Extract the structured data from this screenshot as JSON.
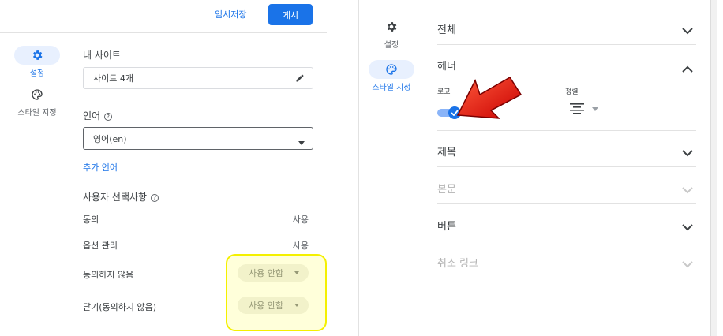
{
  "left_panel": {
    "topbar": {
      "draft_label": "임시저장",
      "publish_label": "게시"
    },
    "rail": [
      {
        "label": "설정",
        "icon": "gear-icon",
        "active": true
      },
      {
        "label": "스타일 지정",
        "icon": "palette-icon",
        "active": false
      }
    ],
    "my_site": {
      "title": "내 사이트",
      "value": "사이트 4개"
    },
    "language": {
      "title": "언어",
      "selected": "영어(en)",
      "add_label": "추가 언어"
    },
    "preferences": {
      "title": "사용자 선택사항",
      "rows": [
        {
          "label": "동의",
          "value": "사용"
        },
        {
          "label": "옵션 관리",
          "value": "사용"
        },
        {
          "label": "동의하지 않음",
          "value": "사용 안함"
        },
        {
          "label": "닫기(동의하지 않음)",
          "value": "사용 안함"
        }
      ]
    }
  },
  "right_panel": {
    "rail": [
      {
        "label": "설정",
        "icon": "gear-icon",
        "active": false
      },
      {
        "label": "스타일 지정",
        "icon": "palette-icon",
        "active": true
      }
    ],
    "sections": {
      "all": "전체",
      "header": "헤더",
      "title": "제목",
      "body": "본문",
      "button": "버튼",
      "cancel_link": "취소 링크"
    },
    "header_controls": {
      "logo_label": "로고",
      "align_label": "정렬",
      "logo_enabled": true
    }
  },
  "colors": {
    "accent": "#1a73e8",
    "highlight": "#f4f000",
    "arrow": "#e00000"
  }
}
